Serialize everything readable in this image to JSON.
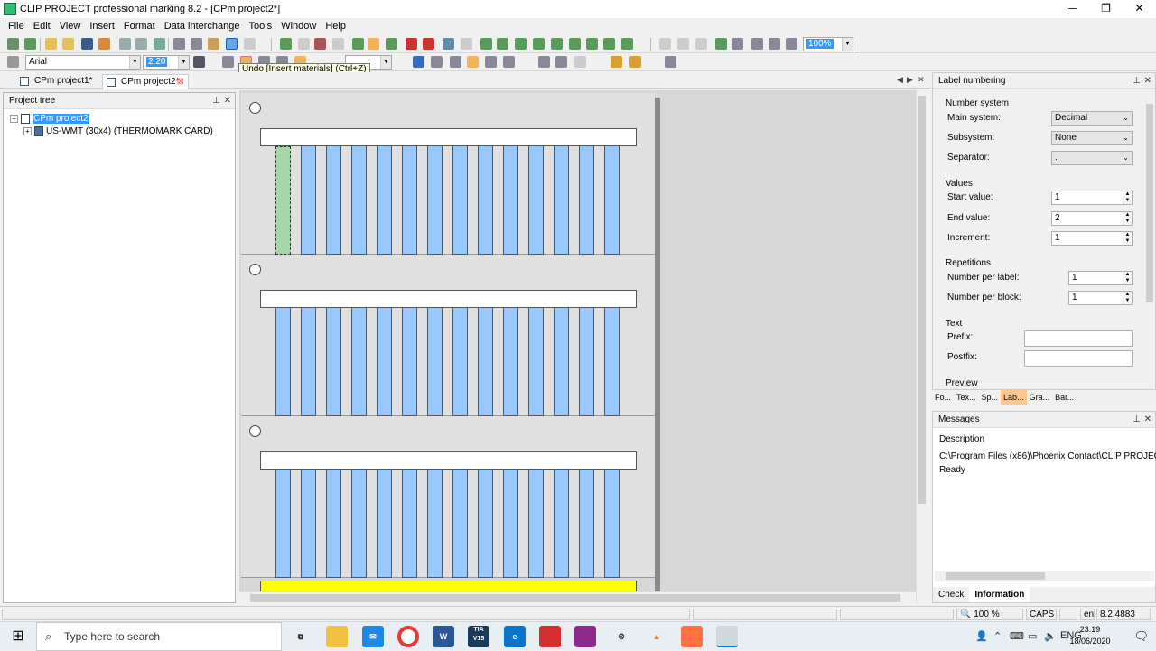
{
  "window": {
    "title": "CLIP PROJECT professional marking 8.2 - [CPm project2*]",
    "controls": [
      "─",
      "❐",
      "✕"
    ]
  },
  "menu": [
    "File",
    "Edit",
    "View",
    "Insert",
    "Format",
    "Data interchange",
    "Tools",
    "Window",
    "Help"
  ],
  "toolbar": {
    "zoom_value": "100%",
    "font_name": "Arial",
    "font_size": "2.20",
    "tooltip": "Undo [Insert materials] (Ctrl+Z)"
  },
  "doc_tabs": [
    {
      "label": "CPm project1*"
    },
    {
      "label": "CPm project2*"
    }
  ],
  "project_tree": {
    "title": "Project tree",
    "root": "CPm project2",
    "child": "US-WMT (30x4) (THERMOMARK CARD)"
  },
  "canvas": {
    "cards": 3,
    "strips_per_card": 14,
    "selected_strip": 0,
    "colors": {
      "strip": "#99c8ff",
      "selected_strip": "#a5d6a7",
      "yellow_bar": "#ffff00"
    }
  },
  "label_numbering": {
    "title": "Label numbering",
    "number_system": {
      "heading": "Number system",
      "main_system_label": "Main system:",
      "main_system_value": "Decimal",
      "subsystem_label": "Subsystem:",
      "subsystem_value": "None",
      "separator_label": "Separator:",
      "separator_value": "."
    },
    "values": {
      "heading": "Values",
      "start_label": "Start value:",
      "start_value": "1",
      "end_label": "End value:",
      "end_value": "2",
      "increment_label": "Increment:",
      "increment_value": "1"
    },
    "repetitions": {
      "heading": "Repetitions",
      "per_label_label": "Number per label:",
      "per_label_value": "1",
      "per_block_label": "Number per block:",
      "per_block_value": "1"
    },
    "text": {
      "heading": "Text",
      "prefix_label": "Prefix:",
      "prefix_value": "",
      "postfix_label": "Postfix:",
      "postfix_value": ""
    },
    "preview_heading": "Preview",
    "tabs": [
      "Fo...",
      "Tex...",
      "Sp...",
      "Lab...",
      "Gra...",
      "Bar..."
    ]
  },
  "messages": {
    "title": "Messages",
    "column": "Description",
    "lines": [
      "C:\\Program Files (x86)\\Phoenix Contact\\CLIP PROJEC...",
      "Ready"
    ],
    "tabs": [
      "Check",
      "Information"
    ]
  },
  "statusbar": {
    "zoom": "100 %",
    "caps": "CAPS",
    "lang": "en",
    "version": "8.2.4883"
  },
  "taskbar": {
    "search_placeholder": "Type here to search",
    "apps": [
      "task-view",
      "file-explorer",
      "chrome",
      "mail",
      "word",
      "tia-portal",
      "edge",
      "acrobat",
      "onenote",
      "settings",
      "vlc",
      "photo",
      "clip-project"
    ],
    "tia_label": "TIA V15",
    "word_label": "W",
    "lang": "ENG",
    "time": "23:19",
    "date": "18/06/2020"
  }
}
